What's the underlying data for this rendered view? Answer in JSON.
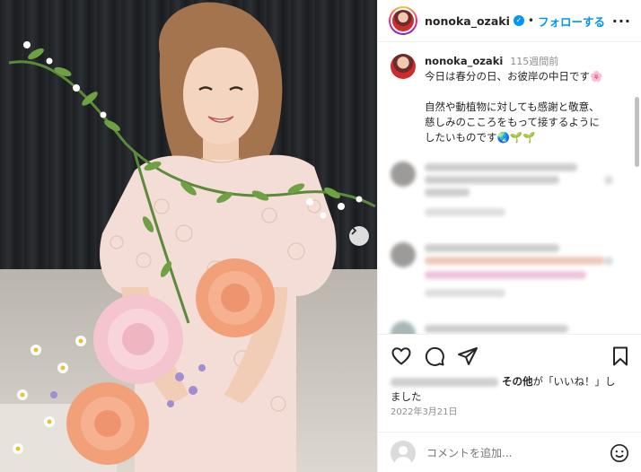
{
  "post": {
    "username": "nonoka_ozaki",
    "follow_label": "フォローする",
    "more_icon": "ellipsis-icon",
    "next_icon": "chevron-right-icon"
  },
  "caption": {
    "username": "nonoka_ozaki",
    "time": "115週間前",
    "lines": [
      "今日は春分の日、お彼岸の中日です🌸",
      "",
      "自然や動植物に対しても感謝と敬意、",
      "慈しみのこころをもって接するように",
      "したいものです🌏🌱🌱"
    ]
  },
  "actions": {
    "like_icon": "heart-icon",
    "comment_icon": "comment-icon",
    "share_icon": "send-icon",
    "save_icon": "bookmark-icon"
  },
  "likes": {
    "others": "その他",
    "rest": "が「いいね！」し",
    "rest2": "ました"
  },
  "date": "2022年3月21日",
  "comment_box": {
    "placeholder": "コメントを追加...",
    "emoji_icon": "smiley-icon"
  },
  "colors": {
    "accent": "#0095f6",
    "text": "#262626",
    "muted": "#8e8e8e",
    "border": "#efefef"
  }
}
